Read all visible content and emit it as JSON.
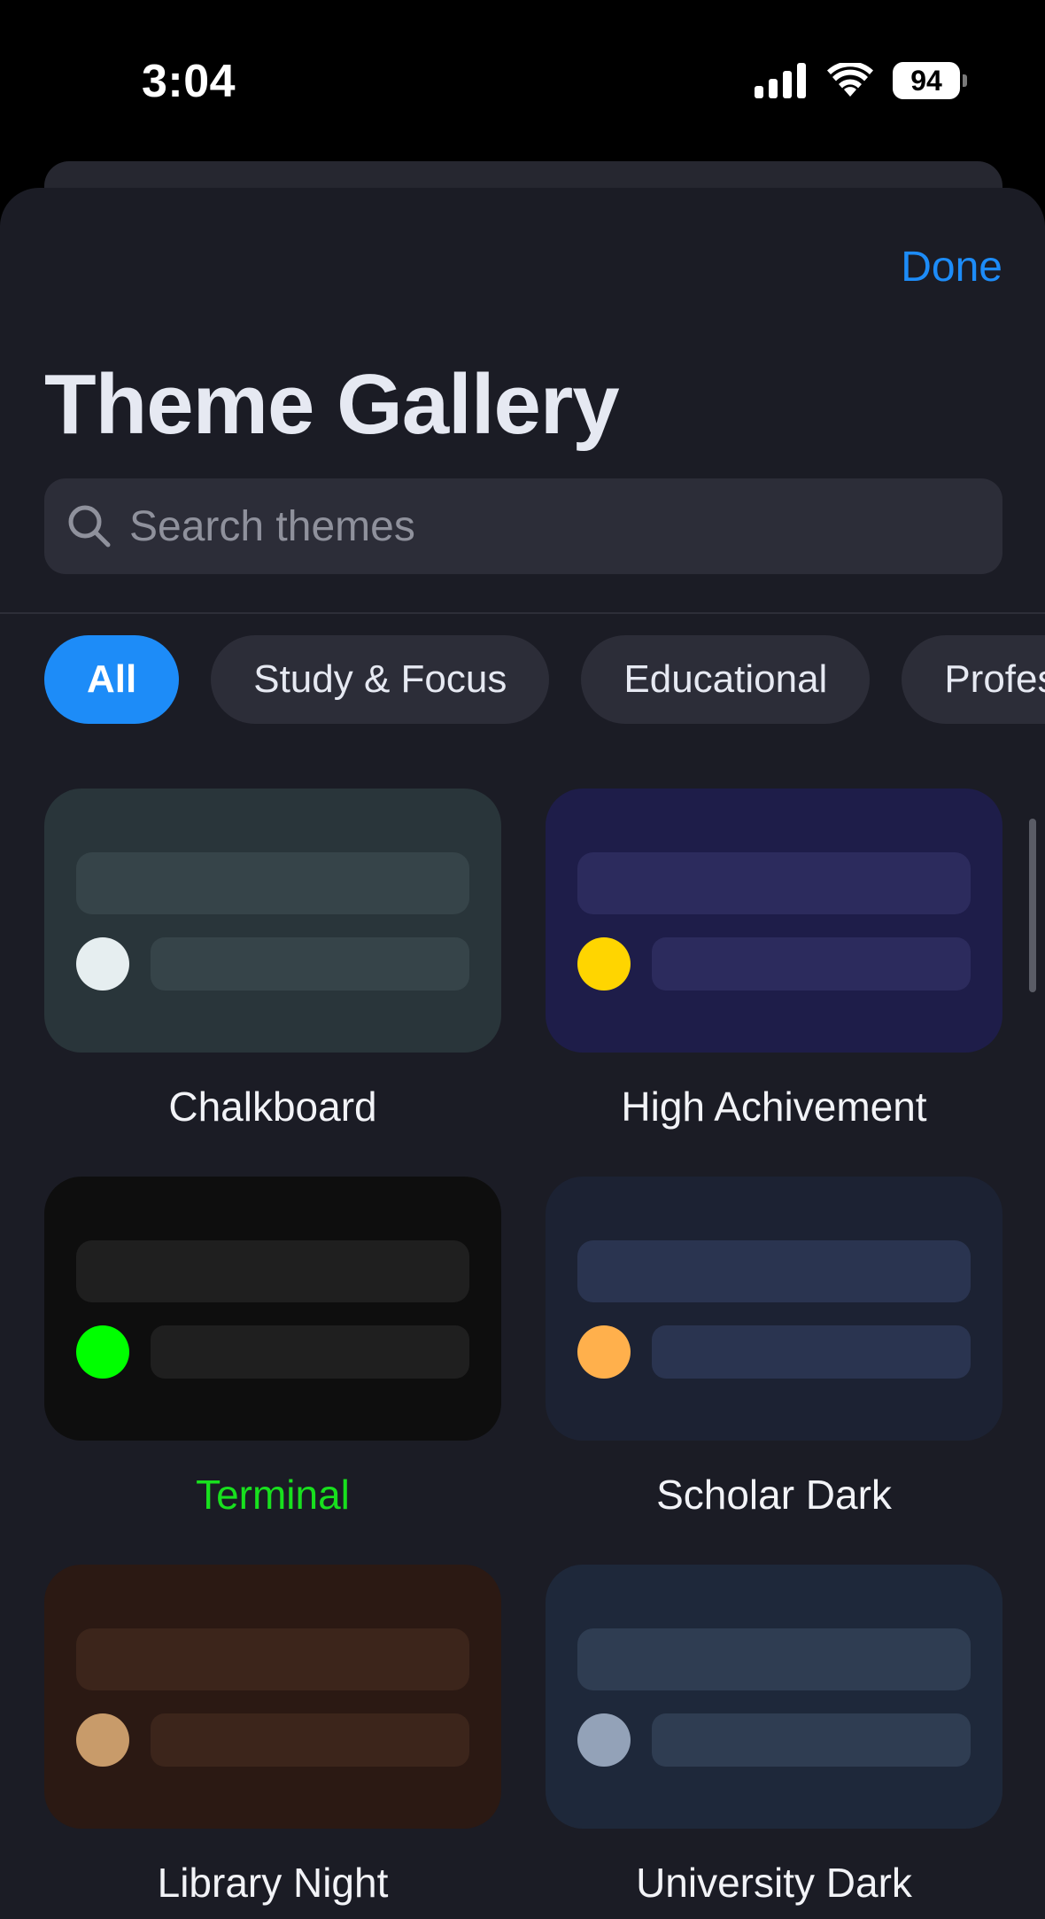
{
  "status": {
    "time": "3:04",
    "battery": "94"
  },
  "header": {
    "done_label": "Done",
    "title": "Theme Gallery"
  },
  "search": {
    "placeholder": "Search themes",
    "value": ""
  },
  "filters": [
    {
      "label": "All",
      "active": true
    },
    {
      "label": "Study & Focus",
      "active": false
    },
    {
      "label": "Educational",
      "active": false
    },
    {
      "label": "Professional",
      "active": false
    }
  ],
  "themes": [
    {
      "name": "Chalkboard",
      "bg": "#29353a",
      "bar": "#364449",
      "dot": "#e6eef0",
      "label_color": "#f2f3f7"
    },
    {
      "name": "High Achivement",
      "bg": "#1e1d49",
      "bar": "#2c2b5d",
      "dot": "#ffd500",
      "label_color": "#f2f3f7"
    },
    {
      "name": "Terminal",
      "bg": "#0e0e0e",
      "bar": "#1f1f1f",
      "dot": "#00ff00",
      "label_color": "#18e01e"
    },
    {
      "name": "Scholar Dark",
      "bg": "#1c2233",
      "bar": "#2a3450",
      "dot": "#ffb04c",
      "label_color": "#f2f3f7"
    },
    {
      "name": "Library Night",
      "bg": "#2b1913",
      "bar": "#3c251b",
      "dot": "#c89b6a",
      "label_color": "#f2f3f7"
    },
    {
      "name": "University Dark",
      "bg": "#1e283a",
      "bar": "#2f3d52",
      "dot": "#93a2b8",
      "label_color": "#f2f3f7"
    }
  ]
}
